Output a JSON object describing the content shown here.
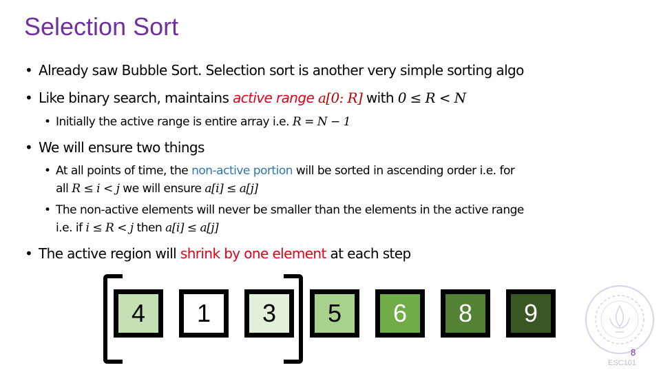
{
  "slide": {
    "title": "Selection Sort",
    "page_number": "8",
    "footer": "ESC101",
    "colors": {
      "title": "#7030A0",
      "highlight_red": "#E2001A",
      "highlight_blue": "#2E75B6"
    }
  },
  "bullets": {
    "b1": {
      "text": "Already saw Bubble Sort. Selection sort is another very simple sorting algo"
    },
    "b2": {
      "pre": "Like binary search, maintains ",
      "highlight": "active range ",
      "math_hl": "a[0: R]",
      "mid": " with ",
      "math": "0 ≤ R < N"
    },
    "b2_sub": {
      "pre": "Initially the active range is entire array i.e. ",
      "math": "R = N − 1"
    },
    "b3": {
      "text": "We will ensure two things"
    },
    "b3_sub1": {
      "pre": "At all points of time, the ",
      "highlight": "non-active portion",
      "post": " will be sorted in ascending order i.e. for",
      "line2_pre": "all ",
      "math1": "R ≤ i < j",
      "line2_mid": " we will ensure ",
      "math2": "a[i] ≤ a[j]"
    },
    "b3_sub2": {
      "text": "The non-active elements will never be smaller than the elements in the active range",
      "line2_pre": "i.e. if ",
      "math1": "i ≤ R < j",
      "line2_mid": " then ",
      "math2": "a[i] ≤ a[j]"
    },
    "b4": {
      "pre": "The active region will ",
      "highlight": "shrink by one element",
      "post": " at each step"
    }
  },
  "array": {
    "values": [
      "4",
      "1",
      "3",
      "5",
      "6",
      "8",
      "9"
    ],
    "fills": [
      "#C5E0B4",
      "#FFFFFF",
      "#E2F0D9",
      "#A9D18E",
      "#70AD47",
      "#548235",
      "#385723"
    ],
    "text_colors": [
      "#000000",
      "#000000",
      "#000000",
      "#000000",
      "#FFFFFF",
      "#FFFFFF",
      "#FFFFFF"
    ],
    "active_range_end_index": 2
  }
}
